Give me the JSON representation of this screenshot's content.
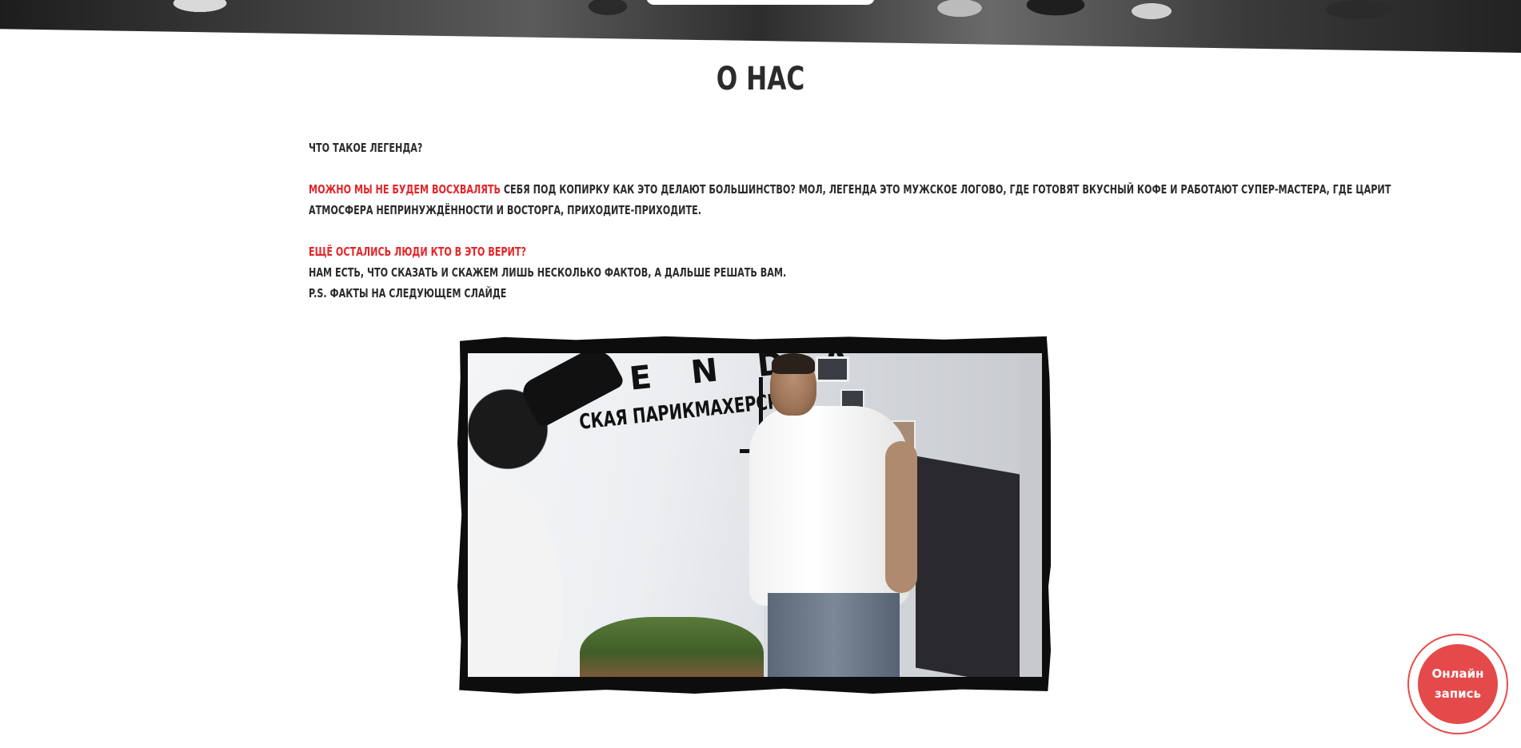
{
  "section": {
    "title": "О НАС"
  },
  "about": {
    "question": "ЧТО ТАКОЕ ЛЕГЕНДА?",
    "para1_red": "МОЖНО МЫ НЕ БУДЕМ ВОСХВАЛЯТЬ",
    "para1_rest_line1": " СЕБЯ ПОД КОПИРКУ КАК ЭТО ДЕЛАЮТ БОЛЬШИНСТВО? МОЛ, ЛЕГЕНДА ЭТО МУЖСКОЕ ЛОГОВО, ГДЕ ГОТОВЯТ ВКУСНЫЙ КОФЕ И РАБОТАЮТ СУПЕР-МАСТЕРА, ГДЕ ЦАРИТ",
    "para1_line2": "АТМОСФЕРА НЕПРИНУЖДЁННОСТИ И ВОСТОРГА, ПРИХОДИТЕ-ПРИХОДИТЕ.",
    "para2_red": "ЕЩЁ ОСТАЛИСЬ ЛЮДИ КТО В ЭТО ВЕРИТ?",
    "para2_line2": "НАМ ЕСТЬ, ЧТО СКАЗАТЬ И СКАЖЕМ ЛИШЬ НЕСКОЛЬКО ФАКТОВ, А ДАЛЬШЕ РЕШАТЬ ВАМ.",
    "para2_line3": "P.S. ФАКТЫ НА СЛЕДУЮЩЕМ СЛАЙДЕ"
  },
  "video": {
    "sign_letters": "E N D A",
    "sign_caption": "СКАЯ ПАРИКМАХЕРСКАЯ"
  },
  "booking": {
    "line1": "Онлайн",
    "line2": "запись"
  },
  "colors": {
    "accent_red": "#e3262b",
    "booking_red": "#e54a4a",
    "text_dark": "#2c2c2c"
  }
}
